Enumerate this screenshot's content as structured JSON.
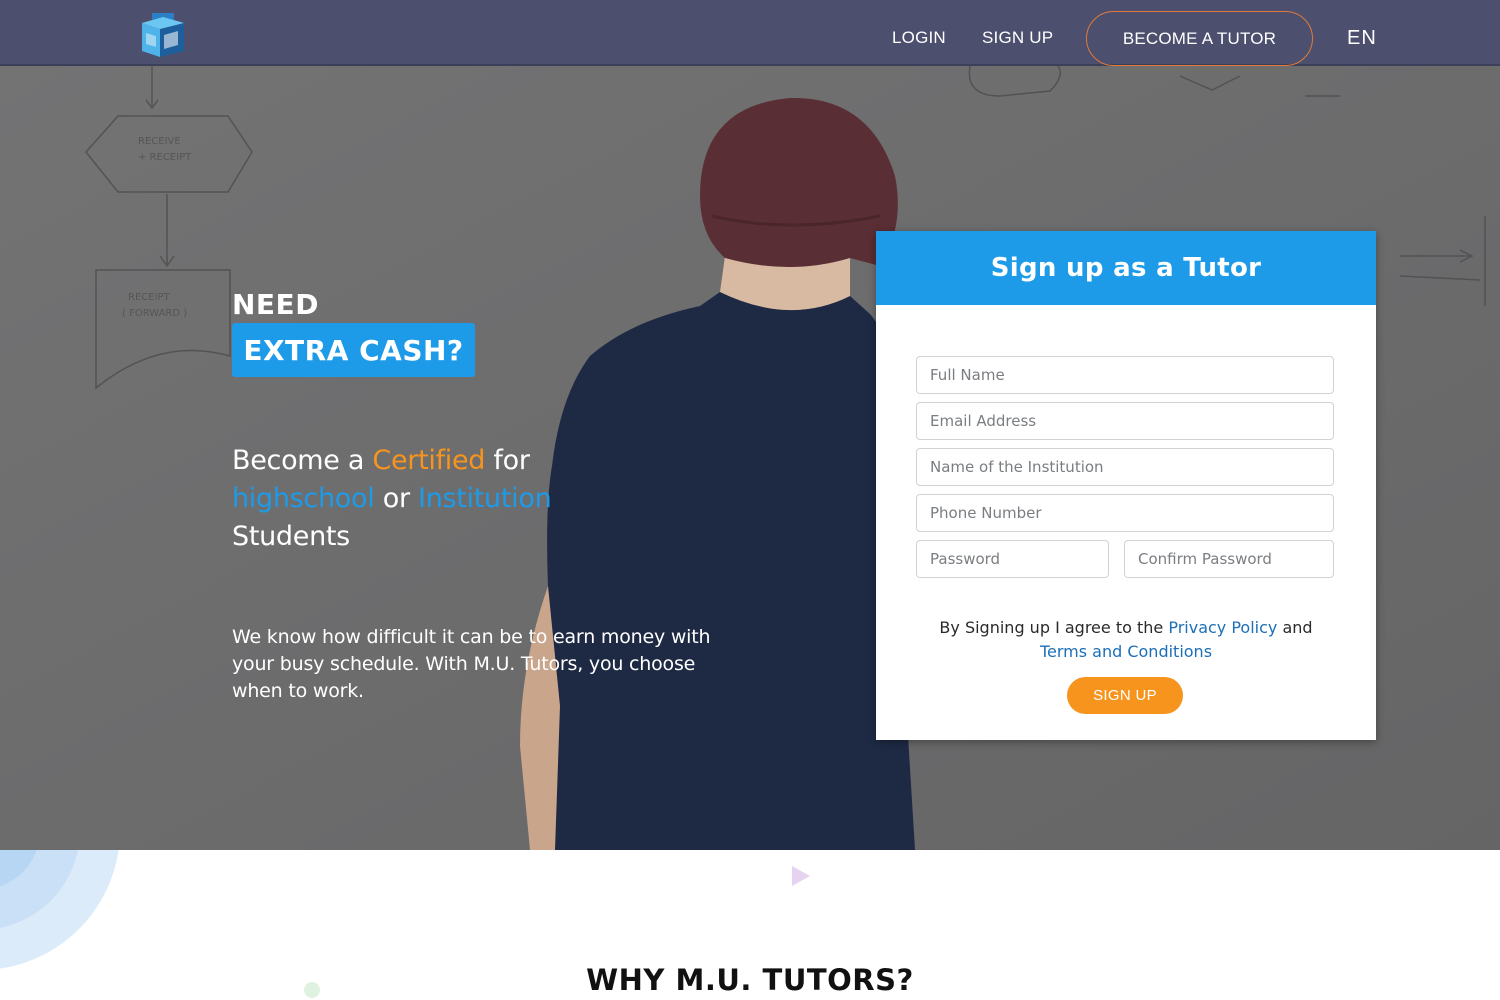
{
  "nav": {
    "login": "LOGIN",
    "signup": "SIGN UP",
    "become_tutor": "BECOME A TUTOR",
    "language": "EN"
  },
  "hero": {
    "headline_1": "NEED",
    "headline_2": "EXTRA CASH?",
    "tagline": {
      "part1": "Become a ",
      "certified": "Certified",
      "part2": " for",
      "highschool": "highschool",
      "or": " or ",
      "institution": "Institution",
      "students": "Students"
    },
    "description": "We know how difficult it can be to earn money with your busy schedule. With M.U. Tutors, you choose when to work."
  },
  "form": {
    "title": "Sign up as a Tutor",
    "full_name_placeholder": "Full Name",
    "email_placeholder": "Email Address",
    "institution_placeholder": "Name of the Institution",
    "phone_placeholder": "Phone Number",
    "password_placeholder": "Password",
    "confirm_password_placeholder": "Confirm Password",
    "agree_text": "By Signing up I agree to the ",
    "privacy_policy": "Privacy Policy",
    "and": " and ",
    "terms": "Terms and Conditions",
    "submit": "SIGN UP"
  },
  "section": {
    "why_title": "WHY M.U. TUTORS?"
  },
  "colors": {
    "navbar": "#4c4f6d",
    "brand_blue": "#1e9be8",
    "accent_orange": "#f7941d",
    "link_blue": "#1c6fb8"
  }
}
